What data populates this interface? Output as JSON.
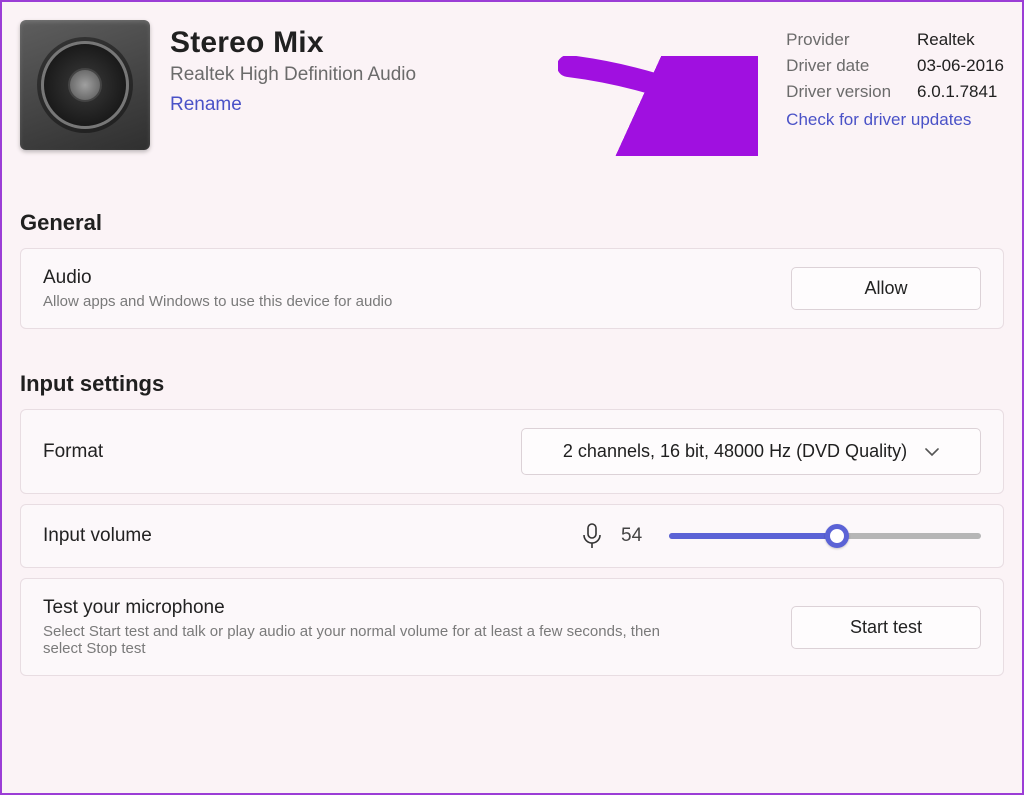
{
  "device": {
    "title": "Stereo Mix",
    "subtitle": "Realtek High Definition Audio",
    "rename": "Rename"
  },
  "info": {
    "provider_label": "Provider",
    "provider_value": "Realtek",
    "date_label": "Driver date",
    "date_value": "03-06-2016",
    "version_label": "Driver version",
    "version_value": "6.0.1.7841",
    "check_updates": "Check for driver updates"
  },
  "sections": {
    "general": "General",
    "input": "Input settings"
  },
  "audio_card": {
    "title": "Audio",
    "desc": "Allow apps and Windows to use this device for audio",
    "button": "Allow"
  },
  "format_card": {
    "title": "Format",
    "value": "2 channels, 16 bit, 48000 Hz (DVD Quality)"
  },
  "volume_card": {
    "title": "Input volume",
    "value": "54",
    "percent": 54
  },
  "test_card": {
    "title": "Test your microphone",
    "desc": "Select Start test and talk or play audio at your normal volume for at least a few seconds, then select Stop test",
    "button": "Start test"
  },
  "colors": {
    "accent": "#5b63d6",
    "link": "#4a52c7",
    "arrow": "#a010e0"
  }
}
